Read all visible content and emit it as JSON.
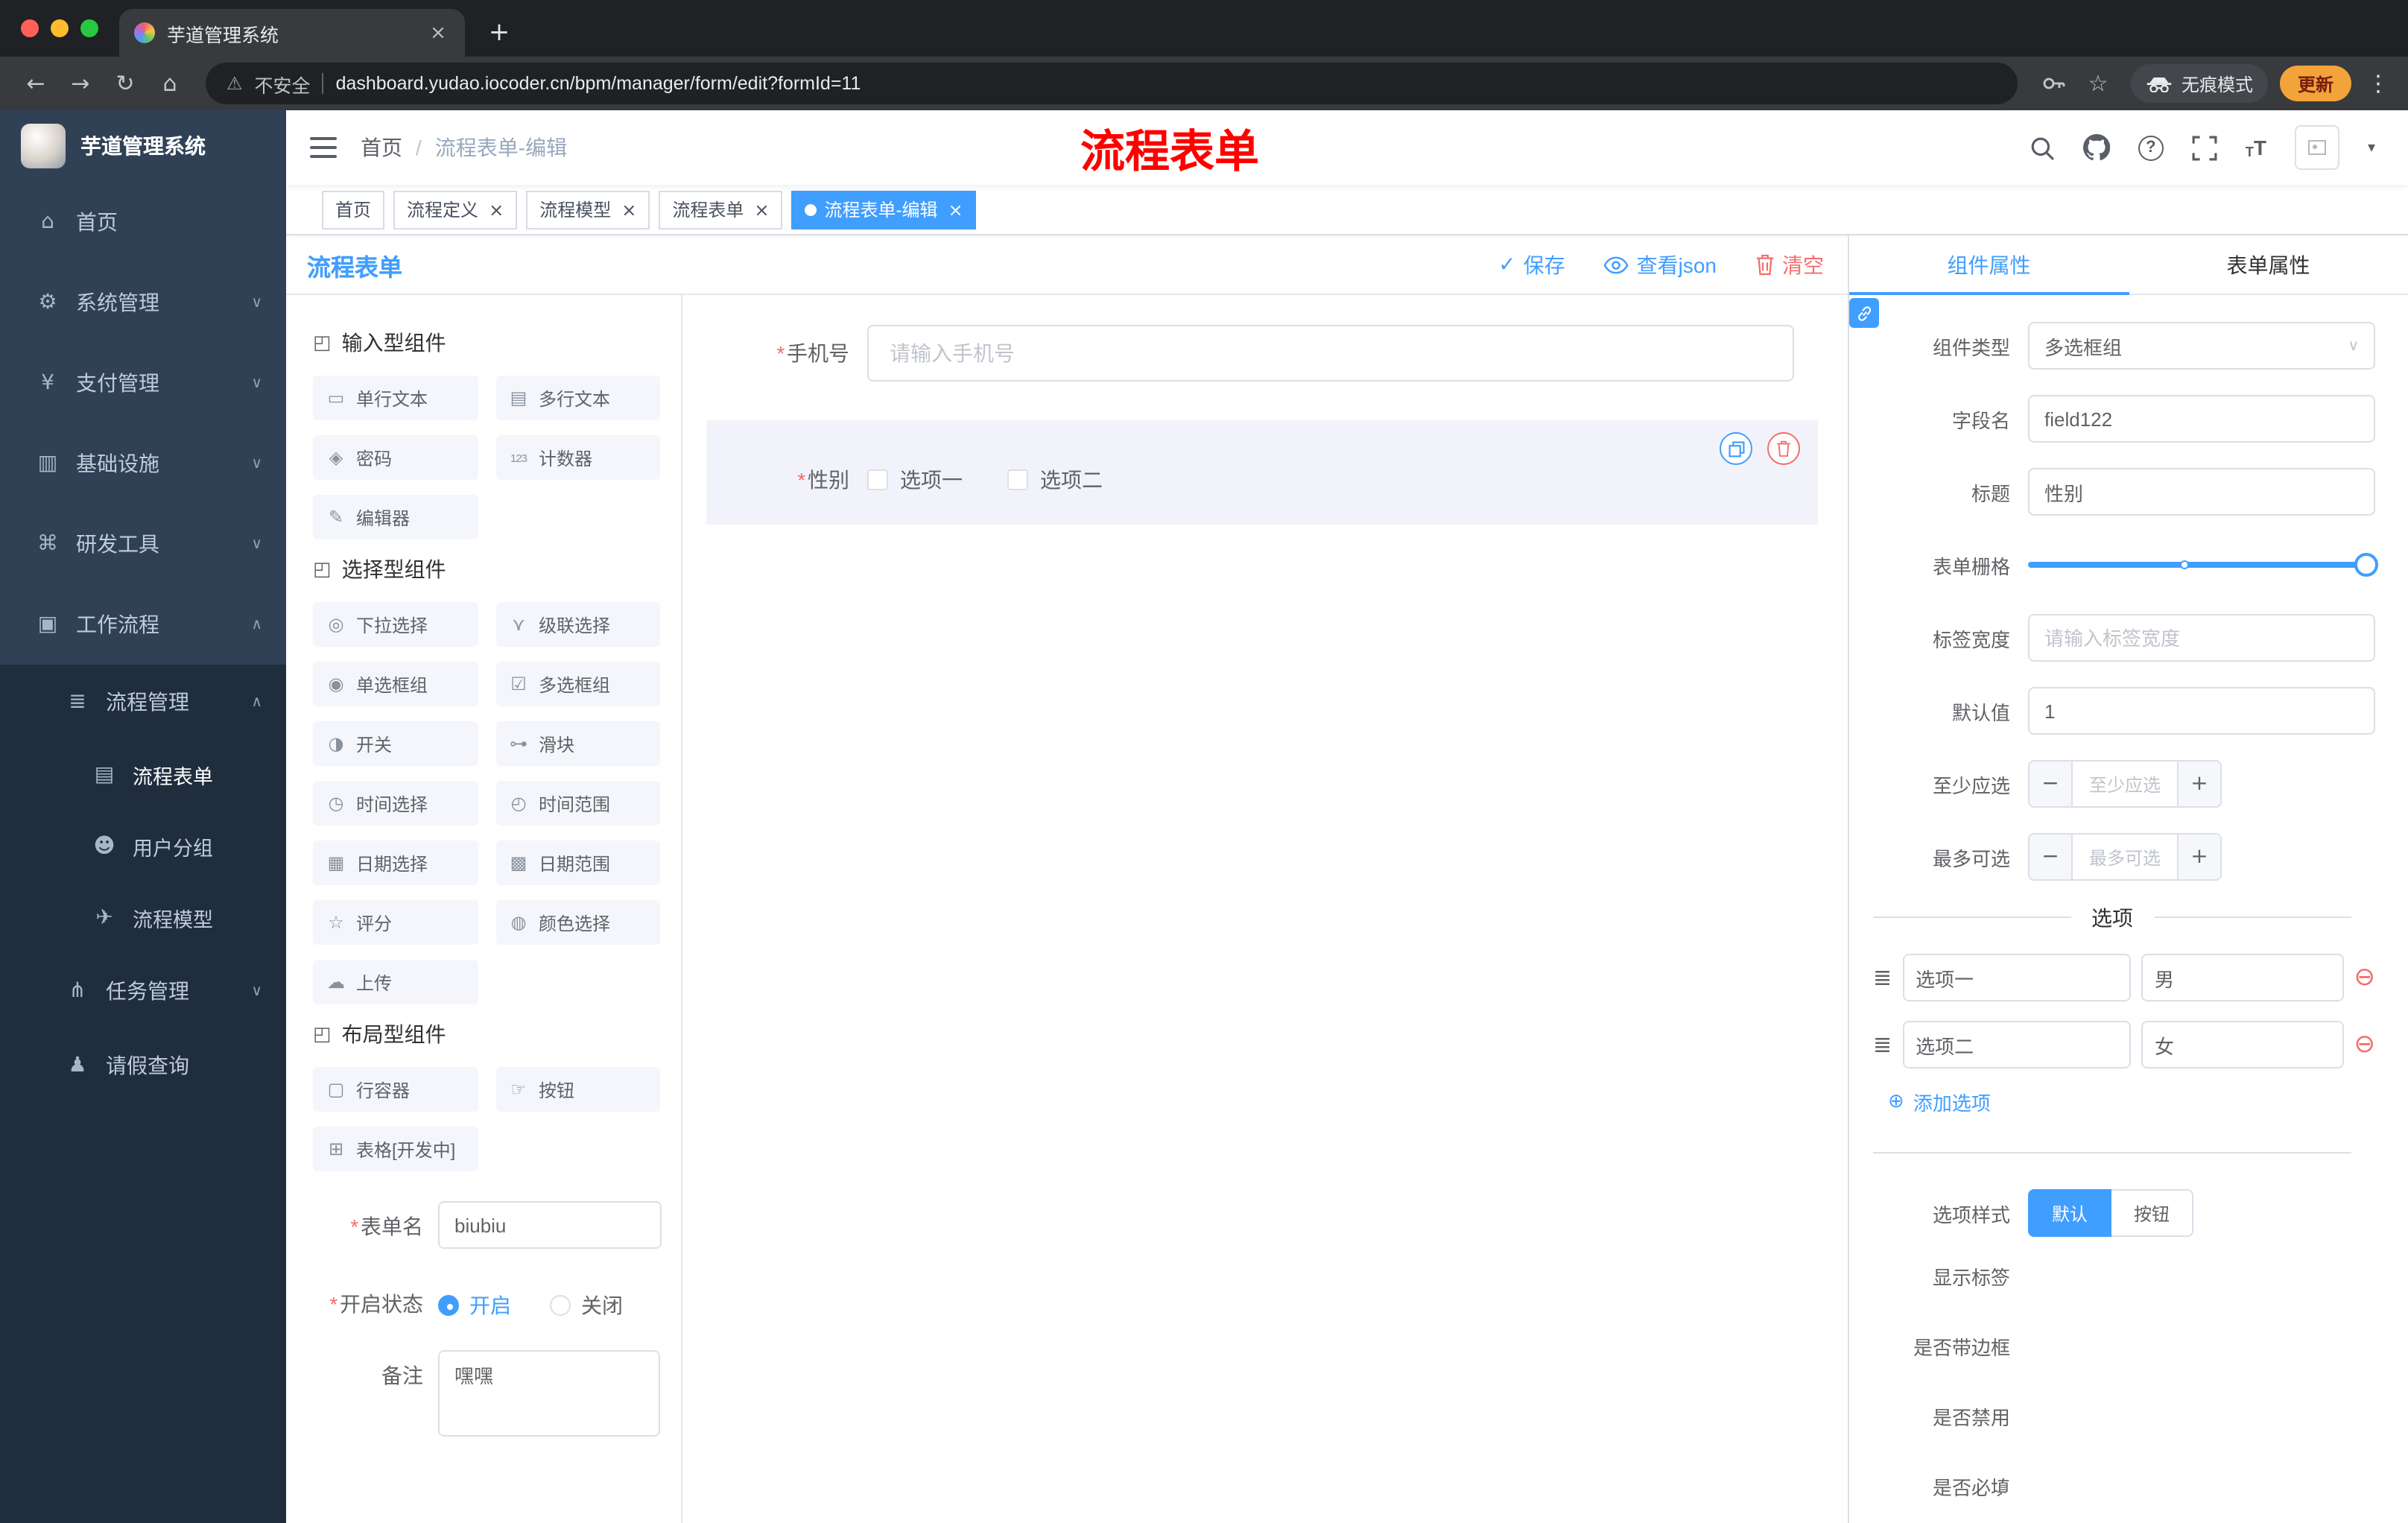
{
  "browser": {
    "tab_title": "芋道管理系统",
    "security_label": "不安全",
    "url": "dashboard.yudao.iocoder.cn/bpm/manager/form/edit?formId=11",
    "incognito_label": "无痕模式",
    "update_label": "更新",
    "nav": {
      "back": "←",
      "forward": "→",
      "reload": "↻",
      "home": "⌂"
    },
    "star": "☆",
    "warning": "⚠",
    "kebab": "⋮",
    "new_tab": "+",
    "close_tab": "×"
  },
  "sidebar": {
    "logo_title": "芋道管理系统",
    "items": [
      {
        "label": "首页",
        "icon": "⌂"
      },
      {
        "label": "系统管理",
        "icon": "⚙",
        "chevron": "∨"
      },
      {
        "label": "支付管理",
        "icon": "¥",
        "chevron": "∨"
      },
      {
        "label": "基础设施",
        "icon": "▥",
        "chevron": "∨"
      },
      {
        "label": "研发工具",
        "icon": "⌘",
        "chevron": "∨"
      },
      {
        "label": "工作流程",
        "icon": "▣",
        "chevron": "∧"
      },
      {
        "label": "流程管理",
        "icon": "≣",
        "chevron": "∧"
      },
      {
        "label": "流程表单",
        "icon": "▤"
      },
      {
        "label": "用户分组",
        "icon": "☻"
      },
      {
        "label": "流程模型",
        "icon": "✈"
      },
      {
        "label": "任务管理",
        "icon": "⋔",
        "chevron": "∨"
      },
      {
        "label": "请假查询",
        "icon": "♟"
      }
    ]
  },
  "header": {
    "breadcrumb_home": "首页",
    "breadcrumb_sep": "/",
    "breadcrumb_current": "流程表单-编辑",
    "annotation": "流程表单",
    "help": "?",
    "font_small": "T",
    "font_large": "T",
    "caret": "▾"
  },
  "tags": [
    {
      "label": "首页"
    },
    {
      "label": "流程定义"
    },
    {
      "label": "流程模型"
    },
    {
      "label": "流程表单"
    },
    {
      "label": "流程表单-编辑"
    }
  ],
  "designer": {
    "title": "流程表单",
    "save": "保存",
    "view_json": "查看json",
    "clear": "清空",
    "groups": [
      {
        "title": "输入型组件",
        "icon": "◰",
        "items": [
          {
            "label": "单行文本",
            "icon": "▭"
          },
          {
            "label": "多行文本",
            "icon": "▤"
          },
          {
            "label": "密码",
            "icon": "◈"
          },
          {
            "label": "计数器",
            "icon": "123"
          },
          {
            "label": "编辑器",
            "icon": "✎"
          }
        ]
      },
      {
        "title": "选择型组件",
        "icon": "◰",
        "items": [
          {
            "label": "下拉选择",
            "icon": "◎"
          },
          {
            "label": "级联选择",
            "icon": "⋎"
          },
          {
            "label": "单选框组",
            "icon": "◉"
          },
          {
            "label": "多选框组",
            "icon": "☑"
          },
          {
            "label": "开关",
            "icon": "◑"
          },
          {
            "label": "滑块",
            "icon": "⊶"
          },
          {
            "label": "时间选择",
            "icon": "◷"
          },
          {
            "label": "时间范围",
            "icon": "◴"
          },
          {
            "label": "日期选择",
            "icon": "▦"
          },
          {
            "label": "日期范围",
            "icon": "▩"
          },
          {
            "label": "评分",
            "icon": "☆"
          },
          {
            "label": "颜色选择",
            "icon": "◍"
          },
          {
            "label": "上传",
            "icon": "☁"
          }
        ]
      },
      {
        "title": "布局型组件",
        "icon": "◰",
        "items": [
          {
            "label": "行容器",
            "icon": "▢"
          },
          {
            "label": "按钮",
            "icon": "☞"
          },
          {
            "label": "表格[开发中]",
            "icon": "⊞"
          }
        ]
      }
    ],
    "meta": {
      "name_label": "表单名",
      "name_value": "biubiu",
      "status_label": "开启状态",
      "status_on": "开启",
      "status_off": "关闭",
      "remark_label": "备注",
      "remark_value": "嘿嘿"
    },
    "canvas": {
      "phone_label": "手机号",
      "phone_placeholder": "请输入手机号",
      "gender_label": "性别",
      "gender_options": [
        "选项一",
        "选项二"
      ]
    }
  },
  "props": {
    "tab_component": "组件属性",
    "tab_form": "表单属性",
    "type_label": "组件类型",
    "type_value": "多选框组",
    "field_label": "字段名",
    "field_value": "field122",
    "title_label": "标题",
    "title_value": "性别",
    "grid_label": "表单栅格",
    "label_width_label": "标签宽度",
    "label_width_placeholder": "请输入标签宽度",
    "default_label": "默认值",
    "default_value": "1",
    "min_label": "至少应选",
    "min_placeholder": "至少应选",
    "max_label": "最多可选",
    "max_placeholder": "最多可选",
    "options_title": "选项",
    "options": [
      {
        "label": "选项一",
        "value": "男"
      },
      {
        "label": "选项二",
        "value": "女"
      }
    ],
    "add_option": "添加选项",
    "style_label": "选项样式",
    "style_default": "默认",
    "style_button": "按钮",
    "toggles": [
      {
        "label": "显示标签",
        "on": true
      },
      {
        "label": "是否带边框",
        "on": false
      },
      {
        "label": "是否禁用",
        "on": false
      },
      {
        "label": "是否必填",
        "on": true
      }
    ]
  },
  "ui": {
    "required": "*",
    "chevron_down": "∨",
    "chevron_up": "∧",
    "close": "×",
    "minus": "−",
    "plus": "+",
    "handle": "≣",
    "remove_circle": "⊖",
    "add_circle": "⊕",
    "check": "✓"
  },
  "colors": {
    "accent": "#409eff",
    "danger": "#f56c6c",
    "sidebar": "#304156",
    "submenu": "#1f2d3d",
    "annotation": "#ff0000"
  }
}
